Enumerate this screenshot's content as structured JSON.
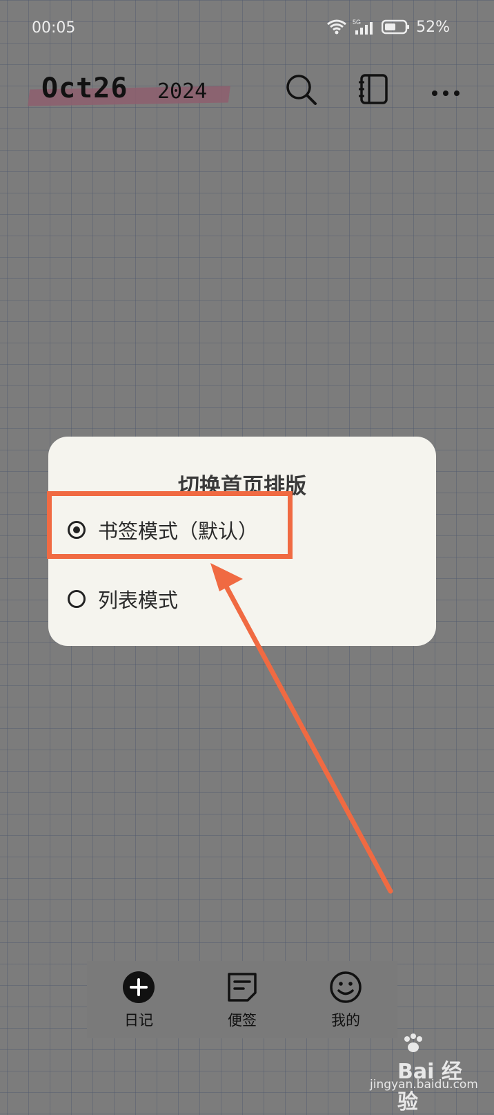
{
  "status_bar": {
    "time": "00:05",
    "network": "5G",
    "battery_percent": "52%"
  },
  "header": {
    "date_month_day": "Oct26",
    "date_year": "2024",
    "icons": [
      "search-icon",
      "notebook-icon",
      "more-icon"
    ]
  },
  "dialog": {
    "title": "切换首页排版",
    "options": [
      {
        "label": "书签模式（默认）",
        "selected": true
      },
      {
        "label": "列表模式",
        "selected": false
      }
    ]
  },
  "bottom_nav": {
    "items": [
      {
        "label": "日记",
        "icon": "add-circle-icon"
      },
      {
        "label": "便签",
        "icon": "note-icon"
      },
      {
        "label": "我的",
        "icon": "smile-icon"
      }
    ]
  },
  "watermark": {
    "brand": "Bai 经验",
    "url": "jingyan.baidu.com"
  },
  "colors": {
    "background": "#7c7c7c",
    "dialog_bg": "#f5f4ee",
    "annotation": "#f06a42",
    "date_strip": "#8e5f6e"
  }
}
